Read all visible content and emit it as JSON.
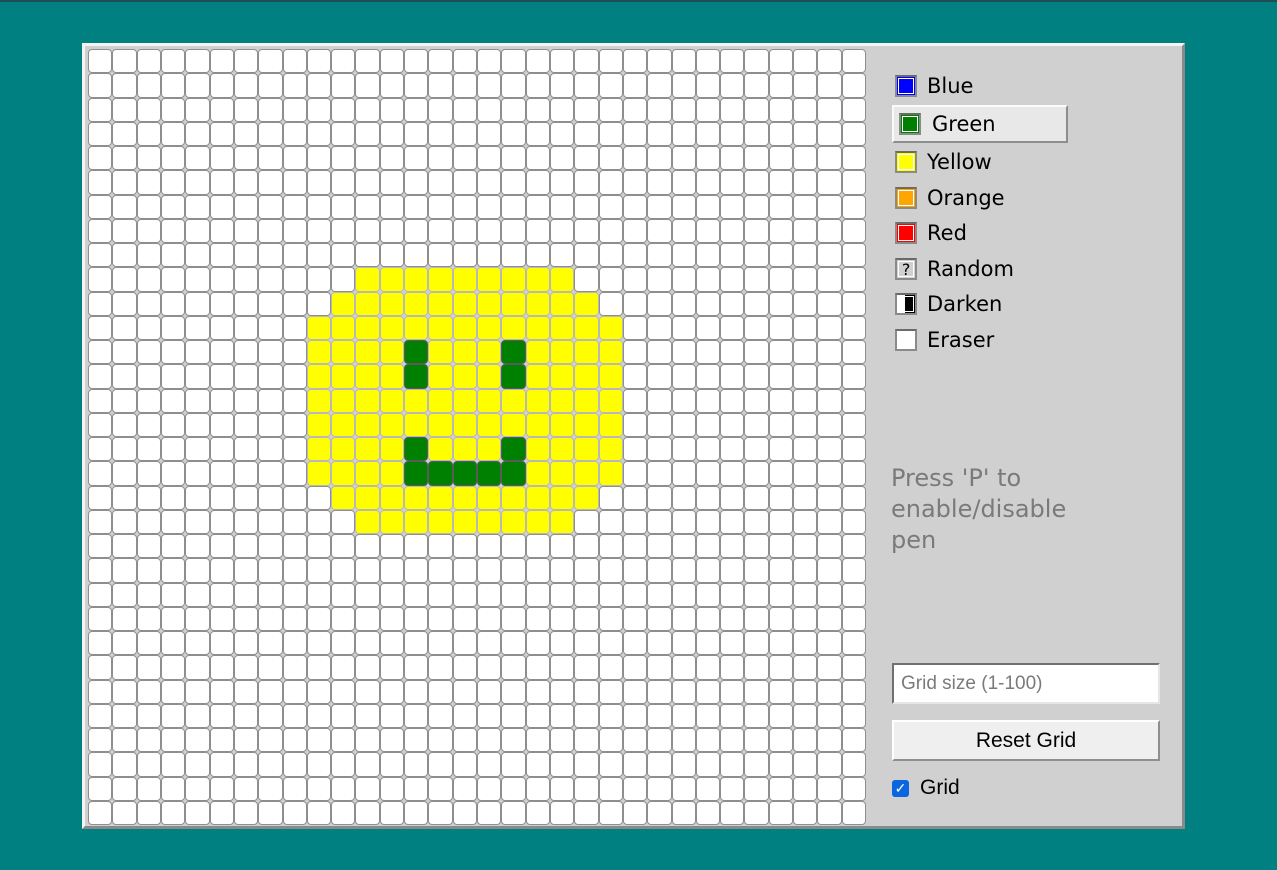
{
  "palette": {
    "items": [
      {
        "label": "Blue",
        "color": "#0000ff",
        "icon": "blue-swatch"
      },
      {
        "label": "Green",
        "color": "#008000",
        "icon": "green-swatch",
        "active": true
      },
      {
        "label": "Yellow",
        "color": "#ffff00",
        "icon": "yellow-swatch"
      },
      {
        "label": "Orange",
        "color": "#ffa500",
        "icon": "orange-swatch"
      },
      {
        "label": "Red",
        "color": "#ff0000",
        "icon": "red-swatch"
      },
      {
        "label": "Random",
        "color": "#d0d0d0",
        "icon": "question-mark-icon",
        "glyph": "?"
      },
      {
        "label": "Darken",
        "color": "#000000",
        "icon": "darken-icon"
      },
      {
        "label": "Eraser",
        "color": "#ffffff",
        "icon": "eraser-icon"
      }
    ]
  },
  "hint": {
    "text": "Press 'P' to enable/disable pen"
  },
  "size_input": {
    "placeholder": "Grid size (1-100)",
    "value": ""
  },
  "reset_button": {
    "label": "Reset Grid"
  },
  "grid_toggle": {
    "label": "Grid",
    "checked": true
  },
  "canvas": {
    "columns": 32,
    "rows": 32,
    "default_color": "#ffffff",
    "pixels": [
      {
        "row": 9,
        "cols": [
          11,
          12,
          13,
          14,
          15,
          16,
          17,
          18,
          19
        ],
        "color": "yellow"
      },
      {
        "row": 10,
        "cols": [
          10,
          11,
          12,
          13,
          14,
          15,
          16,
          17,
          18,
          19,
          20
        ],
        "color": "yellow"
      },
      {
        "row": 11,
        "cols": [
          9,
          10,
          11,
          12,
          13,
          14,
          15,
          16,
          17,
          18,
          19,
          20,
          21
        ],
        "color": "yellow"
      },
      {
        "row": 12,
        "cols": [
          9,
          10,
          11,
          12,
          14,
          15,
          16,
          18,
          19,
          20,
          21
        ],
        "color": "yellow"
      },
      {
        "row": 12,
        "cols": [
          13,
          17
        ],
        "color": "green"
      },
      {
        "row": 13,
        "cols": [
          9,
          10,
          11,
          12,
          14,
          15,
          16,
          18,
          19,
          20,
          21
        ],
        "color": "yellow"
      },
      {
        "row": 13,
        "cols": [
          13,
          17
        ],
        "color": "green"
      },
      {
        "row": 14,
        "cols": [
          9,
          10,
          11,
          12,
          13,
          14,
          15,
          16,
          17,
          18,
          19,
          20,
          21
        ],
        "color": "yellow"
      },
      {
        "row": 15,
        "cols": [
          9,
          10,
          11,
          12,
          13,
          14,
          15,
          16,
          17,
          18,
          19,
          20,
          21
        ],
        "color": "yellow"
      },
      {
        "row": 16,
        "cols": [
          9,
          10,
          11,
          12,
          14,
          15,
          16,
          18,
          19,
          20,
          21
        ],
        "color": "yellow"
      },
      {
        "row": 16,
        "cols": [
          13,
          17
        ],
        "color": "green"
      },
      {
        "row": 17,
        "cols": [
          9,
          10,
          11,
          12,
          18,
          19,
          20,
          21
        ],
        "color": "yellow"
      },
      {
        "row": 17,
        "cols": [
          13,
          14,
          15,
          16,
          17
        ],
        "color": "green"
      },
      {
        "row": 18,
        "cols": [
          10,
          11,
          12,
          13,
          14,
          15,
          16,
          17,
          18,
          19,
          20
        ],
        "color": "yellow"
      },
      {
        "row": 19,
        "cols": [
          11,
          12,
          13,
          14,
          15,
          16,
          17,
          18,
          19
        ],
        "color": "yellow"
      }
    ]
  }
}
